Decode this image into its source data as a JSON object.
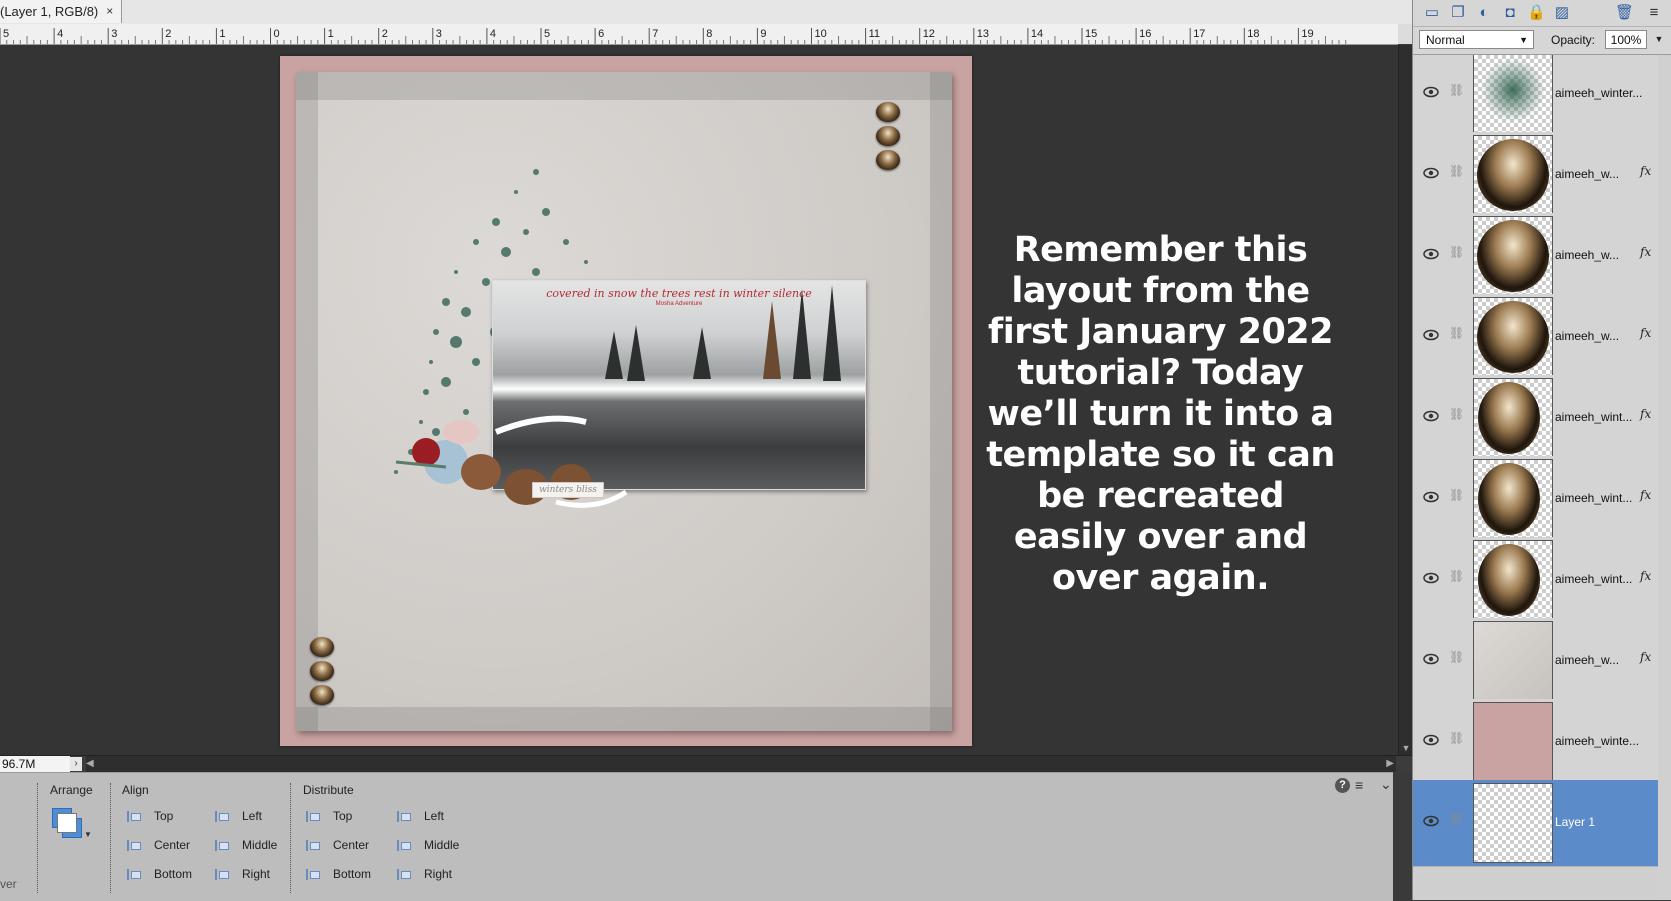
{
  "document_tab": {
    "title": "(Layer 1, RGB/8)",
    "close": "×"
  },
  "ruler": {
    "labels": [
      "5",
      "4",
      "3",
      "2",
      "1",
      "0",
      "1",
      "2",
      "3",
      "4",
      "5",
      "6",
      "7",
      "8",
      "9",
      "10",
      "11",
      "12",
      "13",
      "14",
      "15",
      "16",
      "17",
      "18",
      "19"
    ]
  },
  "status": {
    "zoom": "96.7M"
  },
  "canvas": {
    "photo_caption": "covered in snow the trees rest in winter silence",
    "photo_subcaption": "Mosha Adventure",
    "word_strip": "winters bliss",
    "overlay_text": "Remember this layout from the first January 2022 tutorial? Today we’ll turn it into a template so it can be recreated easily over and over again."
  },
  "tool_options": {
    "left_fragment": "ver",
    "arrange_label": "Arrange",
    "align_label": "Align",
    "distribute_label": "Distribute",
    "align_col1": [
      "Top",
      "Center",
      "Bottom"
    ],
    "align_col2": [
      "Left",
      "Middle",
      "Right"
    ],
    "distribute_col1": [
      "Top",
      "Center",
      "Bottom"
    ],
    "distribute_col2": [
      "Left",
      "Middle",
      "Right"
    ],
    "help": "?"
  },
  "layers_panel": {
    "blend_mode": "Normal",
    "opacity_label": "Opacity:",
    "opacity_value": "100%",
    "layers": [
      {
        "name": "aimeeh_winter...",
        "fx": "",
        "thumb": "splat"
      },
      {
        "name": "aimeeh_w...",
        "fx": "fx",
        "thumb": "brad"
      },
      {
        "name": "aimeeh_w...",
        "fx": "fx",
        "thumb": "brad"
      },
      {
        "name": "aimeeh_w...",
        "fx": "fx",
        "thumb": "brad"
      },
      {
        "name": "aimeeh_wint...",
        "fx": "fx",
        "thumb": "brad-narrow"
      },
      {
        "name": "aimeeh_wint...",
        "fx": "fx",
        "thumb": "brad-narrow"
      },
      {
        "name": "aimeeh_wint...",
        "fx": "fx",
        "thumb": "brad-narrow"
      },
      {
        "name": "aimeeh_w...",
        "fx": "fx",
        "thumb": "paper"
      },
      {
        "name": "aimeeh_winte...",
        "fx": "",
        "thumb": "pink"
      },
      {
        "name": "Layer 1",
        "fx": "",
        "thumb": "transparent",
        "selected": true
      }
    ]
  },
  "colors": {
    "workspace": "#343434",
    "page_border": "#c9a3a1",
    "selection": "#5c8bc9",
    "photo_caption": "#b52a34"
  }
}
